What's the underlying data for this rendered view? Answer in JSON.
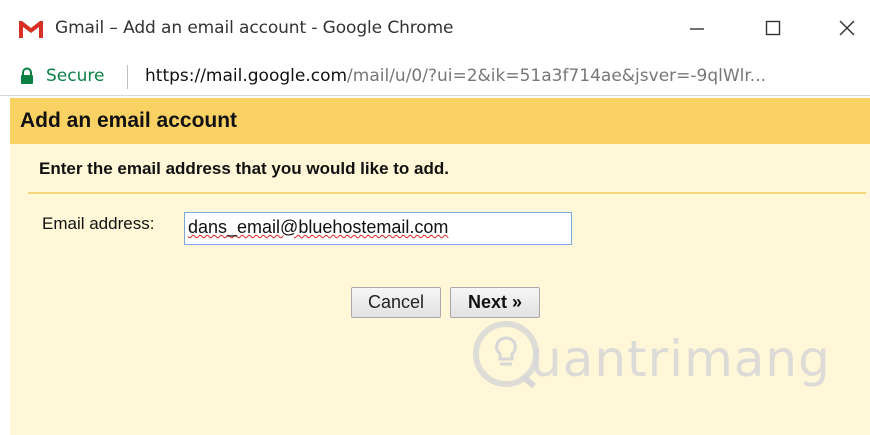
{
  "window": {
    "title": "Gmail – Add an email account - Google Chrome",
    "app_icon": "gmail-logo-icon",
    "controls": [
      "minimize-icon",
      "maximize-icon",
      "close-icon"
    ]
  },
  "addressbar": {
    "secure_label": "Secure",
    "url_host": "https://mail.google.com",
    "url_path": "/mail/u/0/?ui=2&ik=51a3f714ae&jsver=-9qlWlr..."
  },
  "dialog": {
    "title": "Add an email account",
    "instruction": "Enter the email address that you would like to add.",
    "email_label": "Email address:",
    "email_value": "dans_email@bluehostemail.com",
    "cancel_label": "Cancel",
    "next_label": "Next »"
  },
  "colors": {
    "header_bg": "#fad163",
    "dialog_bg": "#fff7d7",
    "secure_green": "#0b8043"
  },
  "watermark": {
    "text": "uantrimang"
  }
}
